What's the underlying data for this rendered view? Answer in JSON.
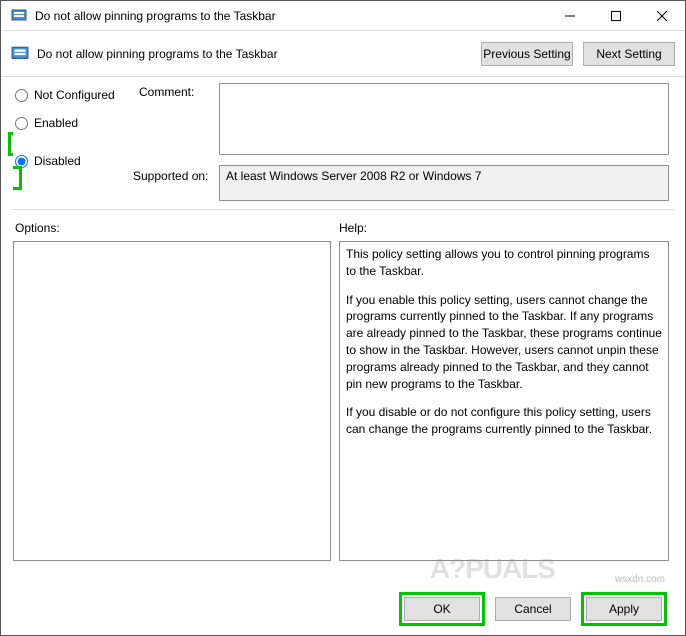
{
  "window": {
    "title": "Do not allow pinning programs to the Taskbar",
    "policy_title": "Do not allow pinning programs to the Taskbar"
  },
  "nav": {
    "previous": "Previous Setting",
    "next": "Next Setting"
  },
  "radios": {
    "not_configured": "Not Configured",
    "enabled": "Enabled",
    "disabled": "Disabled",
    "selected": "disabled"
  },
  "labels": {
    "comment": "Comment:",
    "supported_on": "Supported on:",
    "options": "Options:",
    "help": "Help:"
  },
  "supported_on_text": "At least Windows Server 2008 R2 or Windows 7",
  "help_paragraphs": {
    "p1": "This policy setting allows you to control pinning programs to the Taskbar.",
    "p2": "If you enable this policy setting, users cannot change the programs currently pinned to the Taskbar. If any programs are already pinned to the Taskbar, these programs continue to show in the Taskbar. However, users cannot unpin these programs already pinned to the Taskbar, and they cannot pin new programs to the Taskbar.",
    "p3": "If you disable or do not configure this policy setting, users can change the programs currently pinned to the Taskbar."
  },
  "buttons": {
    "ok": "OK",
    "cancel": "Cancel",
    "apply": "Apply"
  },
  "watermark": "wsxdn.com",
  "logo_text": "A?PUALS"
}
